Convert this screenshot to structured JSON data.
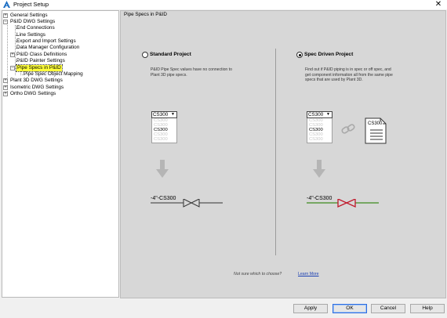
{
  "window": {
    "title": "Project Setup"
  },
  "tree": {
    "items": [
      {
        "label": "General Settings"
      },
      {
        "label": "P&ID DWG Settings"
      },
      {
        "label": "End Connections"
      },
      {
        "label": "Line Settings"
      },
      {
        "label": "Export and Import Settings"
      },
      {
        "label": "Data Manager Configuration"
      },
      {
        "label": "P&ID Class Definitions"
      },
      {
        "label": "P&ID Painter Settings"
      },
      {
        "label": "Pipe Specs in P&ID"
      },
      {
        "label": "Pipe Spec Object Mapping"
      },
      {
        "label": "Plant 3D DWG Settings"
      },
      {
        "label": "Isometric DWG Settings"
      },
      {
        "label": "Ortho DWG Settings"
      }
    ]
  },
  "panel": {
    "title": "Pipe Specs in P&ID",
    "standard": {
      "label": "Standard Project",
      "description": "P&ID Pipe Spec values have no connection to Plant 3D pipe specs.",
      "combo_value": "CS300",
      "combo_options": [
        "CS300",
        "CS300",
        "CS300",
        "CS300",
        "CS300"
      ],
      "pipe_label": "-4\"-CS300",
      "valve_color": "#333333",
      "line_color": "#333333"
    },
    "spec": {
      "label": "Spec Driven Project",
      "description": "Find out if P&ID piping is in spec or off spec, and get component information all from the same pipe specs that are used by Plant 3D.",
      "combo_value": "CS300",
      "combo_options": [
        "CS300",
        "CS300",
        "CS300",
        "CS300",
        "CS300"
      ],
      "doc_label": "CS300",
      "pipe_label": "-4\"-CS300",
      "valve_color": "#c0182a",
      "line_color": "#3c8a1e"
    },
    "help_prompt": "Not sure which to choose?",
    "learn_more": "Learn More",
    "selected_option": "Spec Driven Project"
  },
  "buttons": {
    "apply": "Apply",
    "ok": "OK",
    "cancel": "Cancel",
    "help": "Help"
  }
}
